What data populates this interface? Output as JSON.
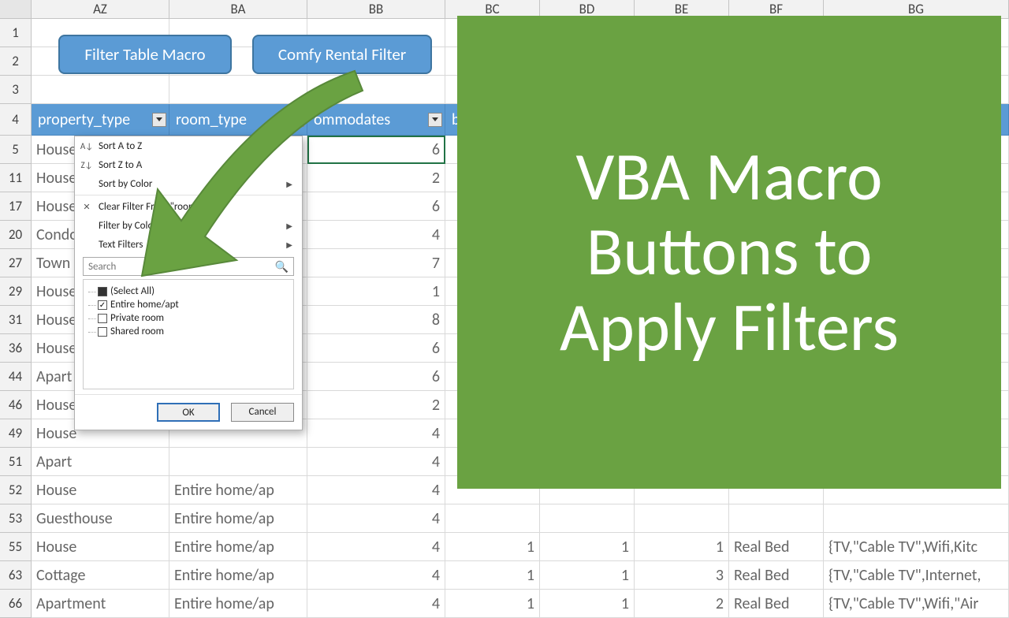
{
  "columns": [
    "AZ",
    "BA",
    "BB",
    "BC",
    "BD",
    "BE",
    "BF",
    "BG"
  ],
  "header_row_num": "4",
  "headers": {
    "az": "property_type",
    "ba": "room_type",
    "bb": "ommodates",
    "bc": "bat"
  },
  "macro_buttons": {
    "filter_table": "Filter Table Macro",
    "comfy": "Comfy Rental Filter"
  },
  "rows": [
    {
      "n": "5",
      "az": "House",
      "ba": "",
      "bb": "6",
      "bc": "",
      "bd": "",
      "be": "",
      "bf": "",
      "bg": ""
    },
    {
      "n": "11",
      "az": "House",
      "ba": "",
      "bb": "2",
      "bc": "",
      "bd": "",
      "be": "",
      "bf": "",
      "bg": ""
    },
    {
      "n": "17",
      "az": "House",
      "ba": "",
      "bb": "6",
      "bc": "",
      "bd": "",
      "be": "",
      "bf": "",
      "bg": ""
    },
    {
      "n": "20",
      "az": "Condo",
      "ba": "",
      "bb": "4",
      "bc": "",
      "bd": "",
      "be": "",
      "bf": "",
      "bg": ""
    },
    {
      "n": "27",
      "az": "Town",
      "ba": "",
      "bb": "7",
      "bc": "",
      "bd": "",
      "be": "",
      "bf": "",
      "bg": ""
    },
    {
      "n": "29",
      "az": "House",
      "ba": "",
      "bb": "1",
      "bc": "",
      "bd": "",
      "be": "",
      "bf": "",
      "bg": ""
    },
    {
      "n": "31",
      "az": "House",
      "ba": "",
      "bb": "8",
      "bc": "",
      "bd": "",
      "be": "",
      "bf": "",
      "bg": ""
    },
    {
      "n": "36",
      "az": "House",
      "ba": "",
      "bb": "6",
      "bc": "",
      "bd": "",
      "be": "",
      "bf": "",
      "bg": ""
    },
    {
      "n": "44",
      "az": "Apart",
      "ba": "",
      "bb": "6",
      "bc": "",
      "bd": "",
      "be": "",
      "bf": "",
      "bg": ""
    },
    {
      "n": "46",
      "az": "House",
      "ba": "",
      "bb": "2",
      "bc": "",
      "bd": "",
      "be": "",
      "bf": "",
      "bg": ""
    },
    {
      "n": "49",
      "az": "House",
      "ba": "",
      "bb": "4",
      "bc": "",
      "bd": "",
      "be": "",
      "bf": "",
      "bg": ""
    },
    {
      "n": "51",
      "az": "Apart",
      "ba": "",
      "bb": "4",
      "bc": "",
      "bd": "",
      "be": "",
      "bf": "",
      "bg": ""
    },
    {
      "n": "52",
      "az": "House",
      "ba": "Entire home/ap",
      "bb": "4",
      "bc": "",
      "bd": "",
      "be": "",
      "bf": "",
      "bg": ""
    },
    {
      "n": "53",
      "az": "Guesthouse",
      "ba": "Entire home/ap",
      "bb": "4",
      "bc": "",
      "bd": "",
      "be": "",
      "bf": "",
      "bg": ""
    },
    {
      "n": "55",
      "az": "House",
      "ba": "Entire home/ap",
      "bb": "4",
      "bc": "1",
      "bd": "1",
      "be": "1",
      "bf": "Real Bed",
      "bg": "{TV,\"Cable TV\",Wifi,Kitc"
    },
    {
      "n": "63",
      "az": "Cottage",
      "ba": "Entire home/ap",
      "bb": "4",
      "bc": "1",
      "bd": "1",
      "be": "3",
      "bf": "Real Bed",
      "bg": "{TV,\"Cable TV\",Internet,"
    },
    {
      "n": "66",
      "az": "Apartment",
      "ba": "Entire home/ap",
      "bb": "4",
      "bc": "1",
      "bd": "1",
      "be": "2",
      "bf": "Real Bed",
      "bg": "{TV,\"Cable TV\",Wifi,\"Air"
    }
  ],
  "filter_menu": {
    "sort_az": "Sort A to Z",
    "sort_za": "Sort Z to A",
    "sort_color": "Sort by Color",
    "clear": "Clear Filter From \"room_t...",
    "filter_color": "Filter by Color",
    "text_filters": "Text Filters",
    "search_placeholder": "Search",
    "items": {
      "select_all": "(Select All)",
      "opt1": "Entire home/apt",
      "opt2": "Private room",
      "opt3": "Shared room"
    },
    "ok": "OK",
    "cancel": "Cancel"
  },
  "panel": {
    "line1": "VBA Macro",
    "line2": "Buttons to",
    "line3": "Apply Filters"
  }
}
